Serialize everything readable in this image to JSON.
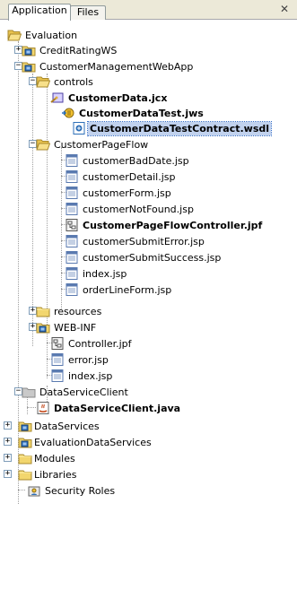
{
  "tabs": {
    "application": "Application",
    "files": "Files",
    "close": "✕"
  },
  "tree": {
    "root": "Evaluation",
    "crs": "CreditRatingWS",
    "cmwa": "CustomerManagementWebApp",
    "controls": "controls",
    "customer_data": "CustomerData.jcx",
    "customer_data_test": "CustomerDataTest.jws",
    "customer_data_test_contract": "CustomerDataTestContract.wsdl",
    "customer_page_flow": "CustomerPageFlow",
    "bad_date": "customerBadDate.jsp",
    "detail": "customerDetail.jsp",
    "form": "customerForm.jsp",
    "not_found": "customerNotFound.jsp",
    "controller_jpf": "CustomerPageFlowController.jpf",
    "submit_error": "customerSubmitError.jsp",
    "submit_success": "customerSubmitSuccess.jsp",
    "index1": "index.jsp",
    "order_line": "orderLineForm.jsp",
    "resources": "resources",
    "webinf": "WEB-INF",
    "controller": "Controller.jpf",
    "error": "error.jsp",
    "index2": "index.jsp",
    "dsc": "DataServiceClient",
    "dsc_java": "DataServiceClient.java",
    "data_services": "DataServices",
    "eval_data_services": "EvaluationDataServices",
    "modules": "Modules",
    "libraries": "Libraries",
    "security_roles": "Security Roles"
  },
  "icons": {
    "folder": "folder-icon",
    "folder_open": "folder-open-icon",
    "project": "project-icon",
    "jsp": "jsp-file-icon",
    "jpf": "page-flow-icon",
    "jcx": "control-icon",
    "jws": "web-service-icon",
    "wsdl": "wsdl-icon",
    "java": "java-file-icon",
    "roles": "security-roles-icon"
  },
  "colors": {
    "tab_bar": "#ece9d8",
    "folder_yellow": "#f2d66e",
    "selection": "#c1d2ee",
    "project_blue": "#2d6fb8"
  }
}
